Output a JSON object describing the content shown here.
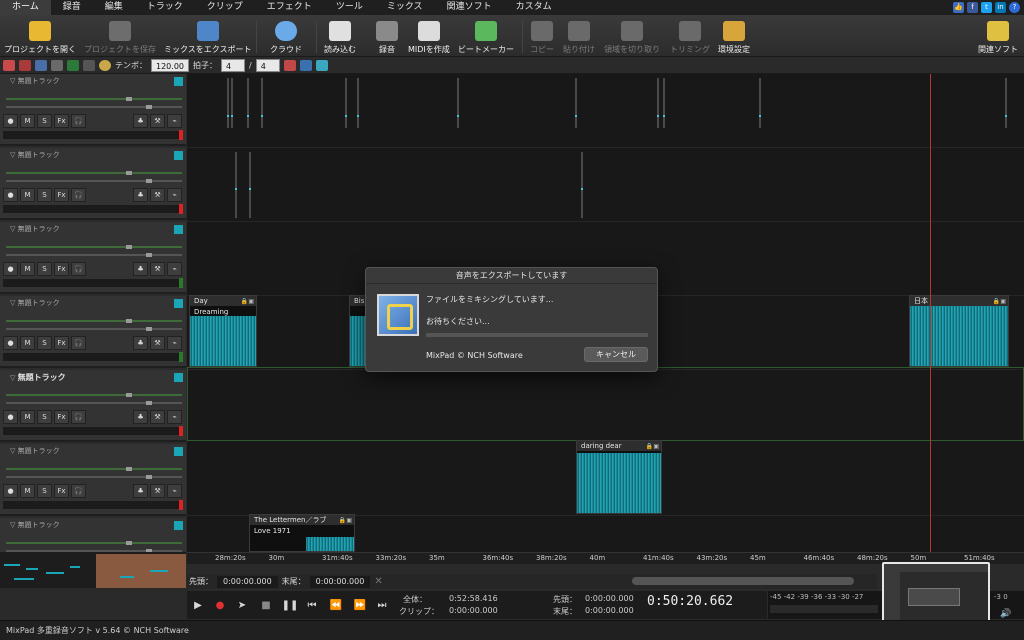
{
  "menu": {
    "items": [
      "ホーム",
      "録音",
      "編集",
      "トラック",
      "クリップ",
      "エフェクト",
      "ツール",
      "ミックス",
      "関連ソフト",
      "カスタム"
    ],
    "active": 0
  },
  "toolbar": {
    "open_project": "プロジェクトを開く",
    "save_project": "プロジェクトを保存",
    "export_mix": "ミックスをエクスポート",
    "cloud": "クラウド",
    "load": "読み込む",
    "record": "録音",
    "create_midi": "MIDIを作成",
    "beat_maker": "ビートメーカー",
    "copy": "コピー",
    "paste": "貼り付け",
    "cut_region": "領域を切り取り",
    "trim": "トリミング",
    "preferences": "環境設定",
    "related_software": "関連ソフト"
  },
  "subbar": {
    "tempo_label": "テンポ：",
    "tempo_value": "120.00",
    "time_sig_label": "拍子：",
    "time_sig_top": "4",
    "time_sig_slash": "/",
    "time_sig_bottom": "4"
  },
  "tracks": [
    {
      "name": "無題トラック",
      "bold": false
    },
    {
      "name": "無題トラック",
      "bold": false
    },
    {
      "name": "無題トラック",
      "bold": false
    },
    {
      "name": "無題トラック",
      "bold": false
    },
    {
      "name": "無題トラック",
      "bold": true
    },
    {
      "name": "無題トラック",
      "bold": false
    },
    {
      "name": "無題トラック",
      "bold": false
    }
  ],
  "track_buttons": {
    "rec": "●",
    "mute": "M",
    "solo": "S",
    "fx": "Fx",
    "phones": "🎧"
  },
  "clips": {
    "day_title": "Day",
    "day_sub": "Dreaming",
    "bis_title": "Bis",
    "nihon_title": "日本",
    "daring_title": "daring dear",
    "letter_title": "The Lettermen／ラブ",
    "letter_sub": "Love 1971"
  },
  "ruler_labels": [
    "28m:20s",
    "30m",
    "31m:40s",
    "33m:20s",
    "35m",
    "36m:40s",
    "38m:20s",
    "40m",
    "41m:40s",
    "43m:20s",
    "45m",
    "46m:40s",
    "48m:20s",
    "50m",
    "51m:40s"
  ],
  "position": {
    "start_label": "先頭：",
    "start_value": "0:00:00.000",
    "end_label": "末尾：",
    "end_value": "0:00:00.000"
  },
  "transport": {
    "total_label": "全体：",
    "total_value": "0:52:58.416",
    "clip_label": "クリップ：",
    "clip_value": "0:00:00.000",
    "sel_start_label": "先頭：",
    "sel_start_value": "0:00:00.000",
    "sel_end_label": "末尾：",
    "sel_end_value": "0:00:00.000",
    "time": "0:50:20.662"
  },
  "vu": {
    "scale": "-45 -42 -39 -36 -33 -30 -27",
    "right": "-3  0"
  },
  "status": {
    "text": "MixPad 多重録音ソフト v 5.64 © NCH Software"
  },
  "modal": {
    "title": "音声をエクスポートしています",
    "line1": "ファイルをミキシングしています...",
    "line2": "お待ちください...",
    "footer": "MixPad © NCH Software",
    "cancel": "キャンセル",
    "progress": 0
  },
  "colors": {
    "accent": "#1aa6b7",
    "playhead": "#b23a2c",
    "background": "#2a2a2a"
  }
}
